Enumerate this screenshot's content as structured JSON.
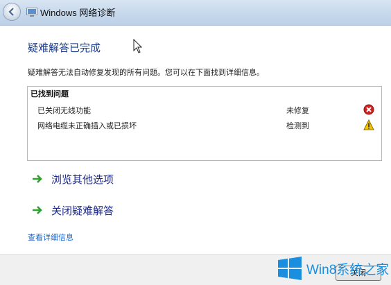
{
  "window": {
    "title": "Windows 网络诊断"
  },
  "main": {
    "heading": "疑难解答已完成",
    "summary": "疑难解答无法自动修复发现的所有问题。您可以在下面找到详细信息。"
  },
  "problems": {
    "header": "已找到问题",
    "items": [
      {
        "name": "已关闭无线功能",
        "status": "未修复",
        "icon": "error-icon"
      },
      {
        "name": "网络电缆未正确插入或已损坏",
        "status": "检测到",
        "icon": "warning-icon"
      }
    ]
  },
  "actions": {
    "explore": "浏览其他选项",
    "close_troubleshooter": "关闭疑难解答",
    "details_link": "查看详细信息"
  },
  "footer": {
    "close_label": "关闭"
  },
  "watermark": {
    "text": "Win8系统之家"
  },
  "colors": {
    "heading": "#1a3c8a",
    "link": "#1e64c8",
    "arrow": "#2fa12f",
    "error": "#d42020",
    "warning": "#f2c500"
  }
}
